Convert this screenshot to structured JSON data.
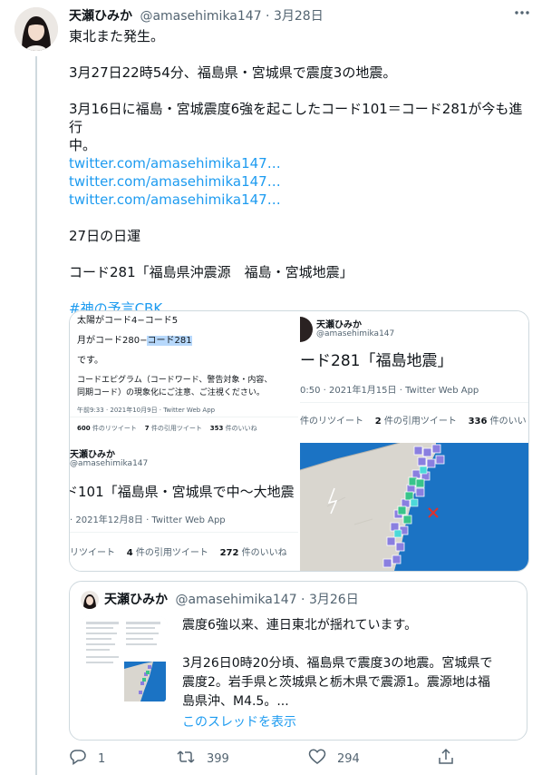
{
  "tweet": {
    "display_name": "天瀬ひみか",
    "handle": "@amasehimika147",
    "separator": " · ",
    "date": "3月28日",
    "more_icon": "more-icon",
    "lines": {
      "l1": "東北また発生。",
      "l2": "3月27日22時54分、福島県・宮城県で震度3の地震。",
      "l3a": "3月16日に福島・宮城震度6強を起こしたコード101＝コード281が今も進行",
      "l3b": "中。",
      "link1": "twitter.com/amasehimika147…",
      "link2": "twitter.com/amasehimika147…",
      "link3": "twitter.com/amasehimika147…",
      "l4": "27日の日運",
      "l5": "コード281「福島県沖震源　福島・宮城地震」",
      "hashtag": "#神の予言CBK"
    },
    "colors": {
      "link": "#1d9bf0",
      "text": "#0f1419",
      "muted": "#536471",
      "border": "#cfd9de"
    }
  },
  "media": {
    "img1": {
      "line1": "太陽がコード4−コード5",
      "line2_prefix": "月がコード280−",
      "line2_highlight": "コード281",
      "line3": "です。",
      "line4": "コードエピグラム（コードワード、警告対象・内容、",
      "line5": "同期コード）の現象化にご注意、ご注視ください。",
      "meta": "午前9:33 · 2021年10月9日 · Twitter Web App",
      "retweets_num": "600",
      "retweets_label": "件のリツイート",
      "quotes_num": "7",
      "quotes_label": "件の引用ツイート",
      "likes_num": "353",
      "likes_label": "件のいいね"
    },
    "img2": {
      "name": "天瀬ひみか",
      "handle": "@amasehimika147",
      "headline": "ード281「福島地震」",
      "meta": "0:50 · 2021年1月15日 · Twitter Web App",
      "retweets_label": "件のリツイート",
      "quotes_num": "2",
      "quotes_label": "件の引用ツイート",
      "likes_num": "336",
      "likes_label": "件のいい"
    },
    "img3": {
      "name": "天瀬ひみか",
      "handle": "@amasehimika147",
      "headline": "ド101「福島県・宮城県で中〜大地震",
      "meta": "· 2021年12月8日 · Twitter Web App",
      "retweets_label": "リツイート",
      "quotes_num": "4",
      "quotes_label": "件の引用ツイート",
      "likes_num": "272",
      "likes_label": "件のいいね"
    },
    "img4": {
      "description_icon": "earthquake-map",
      "colors": {
        "sea": "#1b73c4",
        "land": "#dcd9d2",
        "marker": "#8a7fe0",
        "marker_green": "#39c48a",
        "epicenter": "#e0312b"
      }
    }
  },
  "quote": {
    "display_name": "天瀬ひみか",
    "handle": "@amasehimika147",
    "separator": " · ",
    "date": "3月26日",
    "line1": "震度6強以来、連日東北が揺れています。",
    "line2": "3月26日0時20分頃、福島県で震度3の地震。宮城県で",
    "line3": "震度2。岩手県と茨城県と栃木県で震源1。震源地は福",
    "line4": "島県沖、M4.5。...",
    "show_thread": "このスレッドを表示"
  },
  "actions": {
    "reply_count": "1",
    "retweet_count": "399",
    "like_count": "294",
    "icons": [
      "reply-icon",
      "retweet-icon",
      "like-icon",
      "share-icon"
    ]
  }
}
